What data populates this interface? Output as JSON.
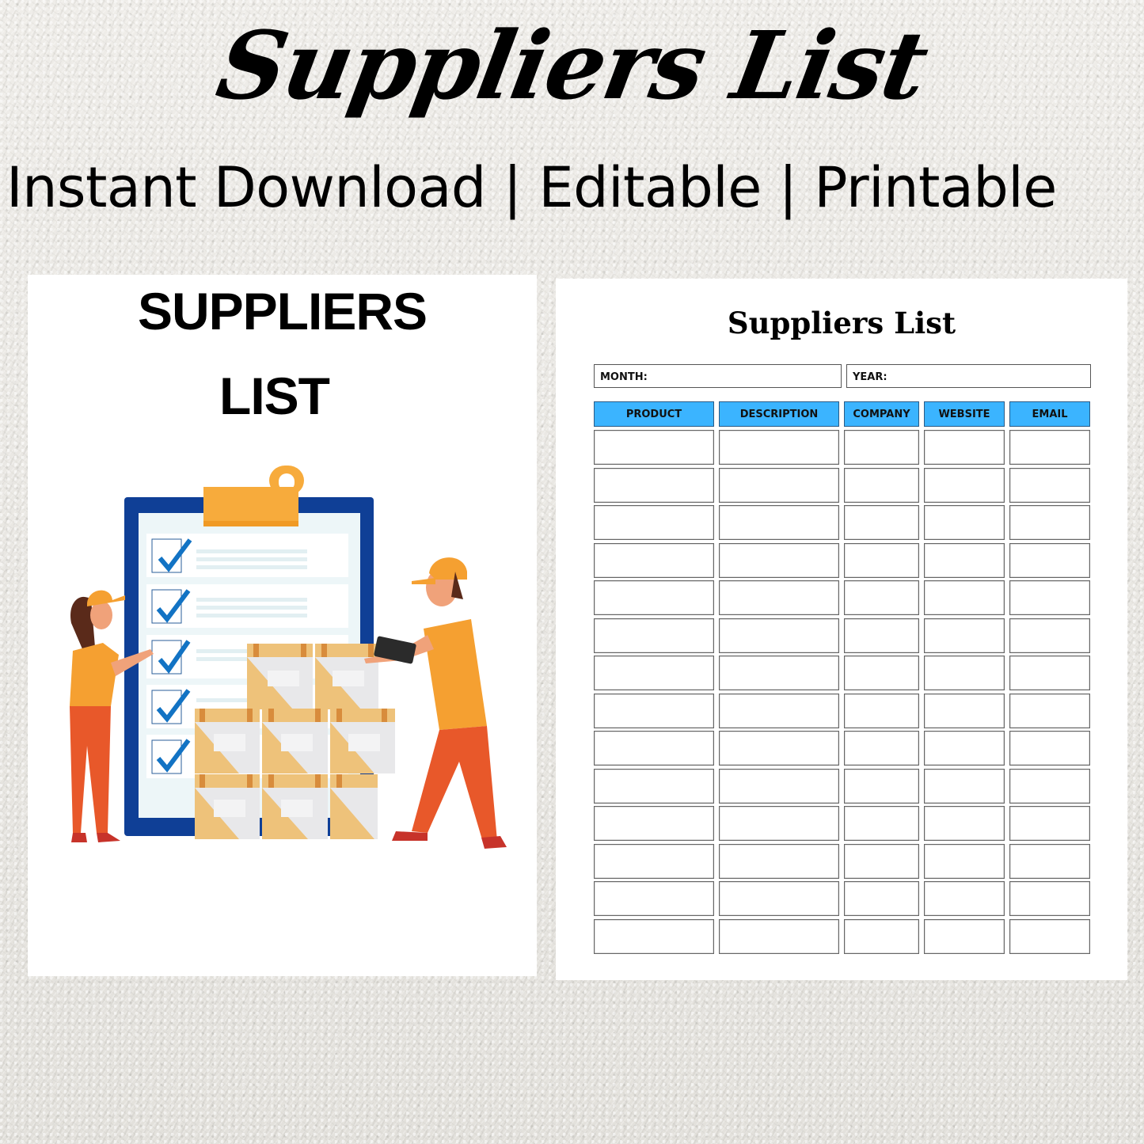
{
  "hero": {
    "title": "Suppliers List",
    "subtitle": "Instant Download | Editable | Printable"
  },
  "cover": {
    "title_line1": "SUPPLIERS",
    "title_line2": "LIST",
    "illustration": "clipboard-checklist-with-workers-and-boxes",
    "colors": {
      "clipboard_frame": "#0f3f96",
      "clip": "#f7ab3c",
      "check": "#1273c4",
      "shirt": "#f5a031",
      "pants": "#e8582a",
      "box": "#eec27a",
      "box_face": "#e8e8ea"
    }
  },
  "sheet": {
    "title": "Suppliers List",
    "month_label": "MONTH:",
    "month_value": "",
    "year_label": "YEAR:",
    "year_value": "",
    "header_color": "#3bb4ff",
    "columns": [
      "PRODUCT",
      "DESCRIPTION",
      "COMPANY",
      "WEBSITE",
      "EMAIL"
    ],
    "rows": [
      [
        "",
        "",
        "",
        "",
        ""
      ],
      [
        "",
        "",
        "",
        "",
        ""
      ],
      [
        "",
        "",
        "",
        "",
        ""
      ],
      [
        "",
        "",
        "",
        "",
        ""
      ],
      [
        "",
        "",
        "",
        "",
        ""
      ],
      [
        "",
        "",
        "",
        "",
        ""
      ],
      [
        "",
        "",
        "",
        "",
        ""
      ],
      [
        "",
        "",
        "",
        "",
        ""
      ],
      [
        "",
        "",
        "",
        "",
        ""
      ],
      [
        "",
        "",
        "",
        "",
        ""
      ],
      [
        "",
        "",
        "",
        "",
        ""
      ],
      [
        "",
        "",
        "",
        "",
        ""
      ],
      [
        "",
        "",
        "",
        "",
        ""
      ],
      [
        "",
        "",
        "",
        "",
        ""
      ]
    ]
  }
}
